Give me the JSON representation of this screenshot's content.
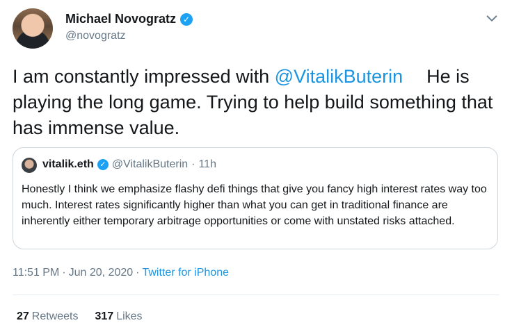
{
  "author": {
    "name": "Michael Novogratz",
    "handle": "@novogratz",
    "verified_icon": "verified-badge-icon"
  },
  "tweet": {
    "text_before_mention": "I am constantly impressed with ",
    "mention": "@VitalikButerin",
    "text_after_mention": "He is playing the long game. Trying to help build something that has immense value."
  },
  "quote": {
    "display_name": "vitalik.eth",
    "handle": "@VitalikButerin",
    "separator": "·",
    "time": "11h",
    "text": "Honestly I think we emphasize flashy defi things that give you fancy high interest rates way too much. Interest rates significantly higher than what you can get in traditional finance are inherently either temporary arbitrage opportunities or come with unstated risks attached."
  },
  "meta": {
    "time": "11:51 PM",
    "date": "Jun 20, 2020",
    "separator": "·",
    "source": "Twitter for iPhone"
  },
  "stats": {
    "retweets_count": "27",
    "retweets_label": "Retweets",
    "likes_count": "317",
    "likes_label": "Likes"
  },
  "colors": {
    "accent": "#1b95e0",
    "verified": "#1da1f2",
    "secondary_text": "#657786",
    "border": "#ccd6dd"
  }
}
